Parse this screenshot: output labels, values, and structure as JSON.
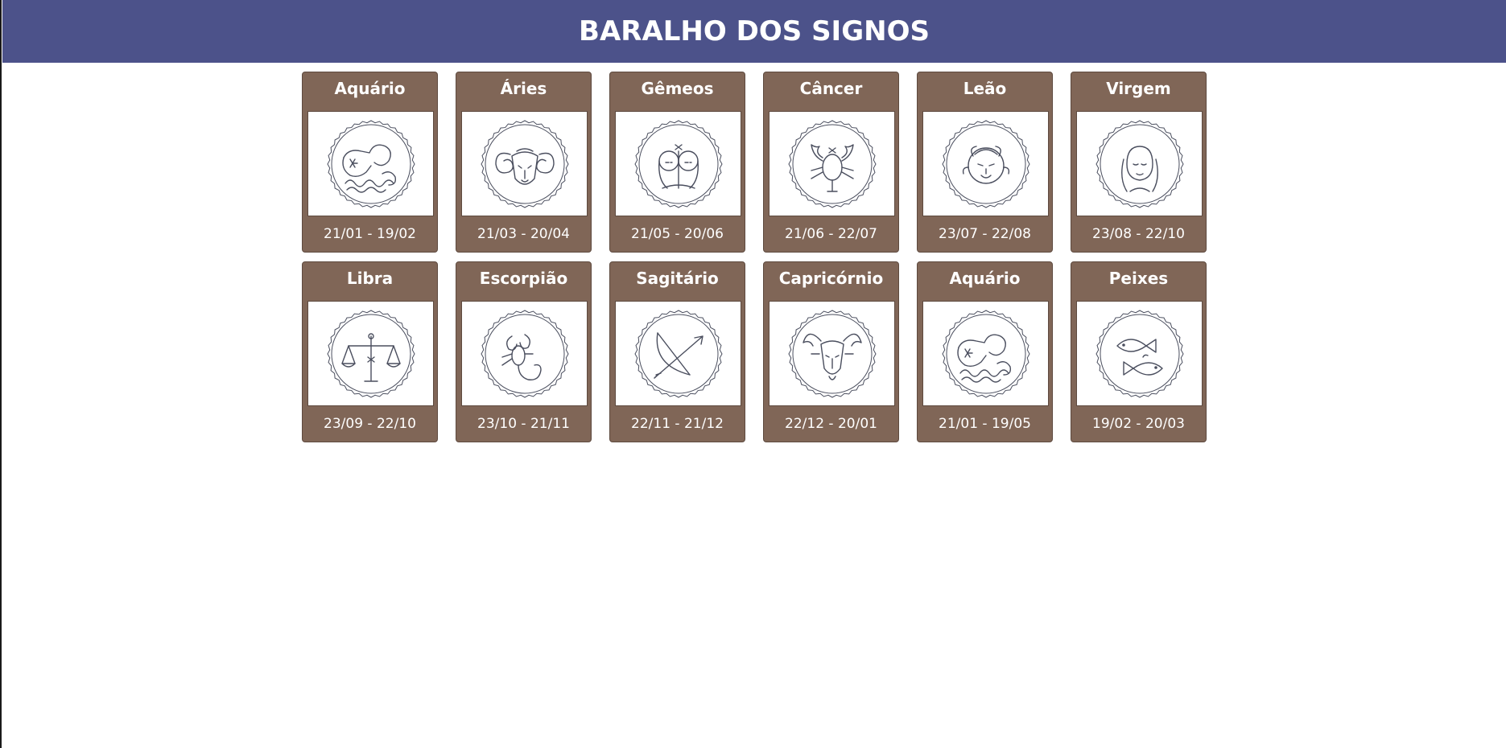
{
  "header": {
    "title": "BARALHO DOS SIGNOS"
  },
  "colors": {
    "header_bg": "#4c528a",
    "card_bg": "#806657",
    "line_art": "#4a4e5e"
  },
  "cards": [
    {
      "name": "Aquário",
      "dates": "21/01 - 19/02",
      "icon": "aquarius-icon"
    },
    {
      "name": "Áries",
      "dates": "21/03 - 20/04",
      "icon": "aries-icon"
    },
    {
      "name": "Gêmeos",
      "dates": "21/05 - 20/06",
      "icon": "gemini-icon"
    },
    {
      "name": "Câncer",
      "dates": "21/06 - 22/07",
      "icon": "cancer-icon"
    },
    {
      "name": "Leão",
      "dates": "23/07 - 22/08",
      "icon": "leo-icon"
    },
    {
      "name": "Virgem",
      "dates": "23/08 - 22/10",
      "icon": "virgo-icon"
    },
    {
      "name": "Libra",
      "dates": "23/09 - 22/10",
      "icon": "libra-icon"
    },
    {
      "name": "Escorpião",
      "dates": "23/10 - 21/11",
      "icon": "scorpio-icon"
    },
    {
      "name": "Sagitário",
      "dates": "22/11 - 21/12",
      "icon": "sagittarius-icon"
    },
    {
      "name": "Capricórnio",
      "dates": "22/12 - 20/01",
      "icon": "capricorn-icon"
    },
    {
      "name": "Aquário",
      "dates": "21/01 - 19/05",
      "icon": "aquarius-icon"
    },
    {
      "name": "Peixes",
      "dates": "19/02 - 20/03",
      "icon": "pisces-icon"
    }
  ]
}
